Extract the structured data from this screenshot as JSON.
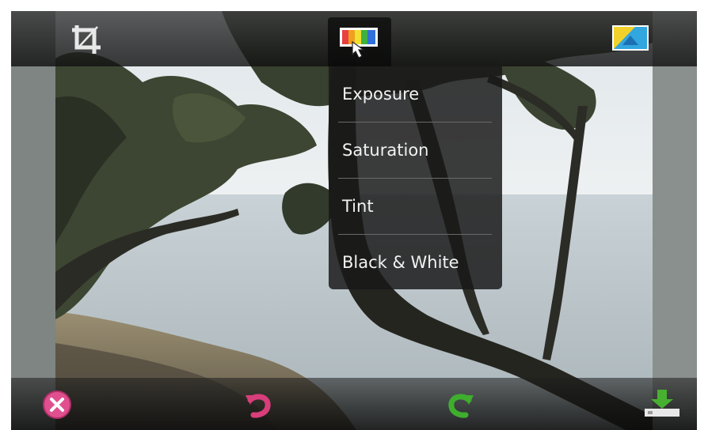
{
  "toolbar": {
    "crop_icon": "crop-icon",
    "color_icon": "color-palette-icon",
    "effects_icon": "effects-icon"
  },
  "color_menu": {
    "items": [
      {
        "label": "Exposure"
      },
      {
        "label": "Saturation"
      },
      {
        "label": "Tint"
      },
      {
        "label": "Black & White"
      }
    ]
  },
  "actions": {
    "cancel_icon": "cancel-icon",
    "undo_icon": "undo-icon",
    "redo_icon": "redo-icon",
    "save_icon": "save-icon"
  },
  "colors": {
    "cancel": "#e0508f",
    "undo": "#d83e7a",
    "redo": "#3fae2e",
    "save": "#48b030",
    "menu_bg": "#181818"
  }
}
